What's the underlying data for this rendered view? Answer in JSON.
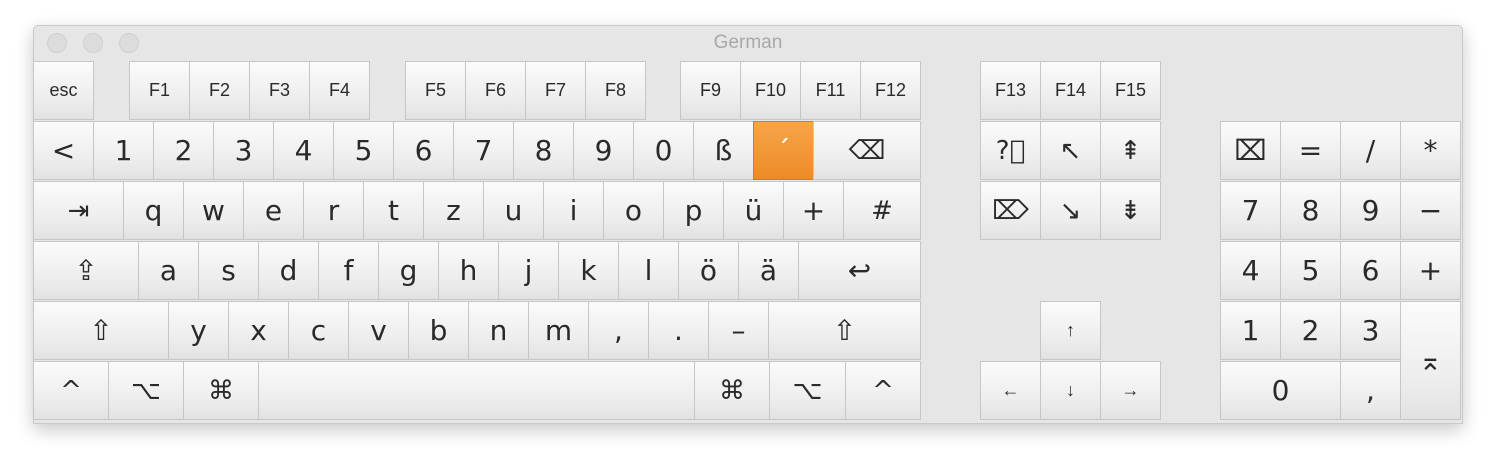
{
  "window": {
    "title": "German",
    "layout": "German"
  },
  "active_key": "´",
  "colors": {
    "active_key": "#F08F2C",
    "background": "#E6E6E6"
  },
  "function_row": [
    "esc",
    "F1",
    "F2",
    "F3",
    "F4",
    "F5",
    "F6",
    "F7",
    "F8",
    "F9",
    "F10",
    "F11",
    "F12",
    "F13",
    "F14",
    "F15"
  ],
  "number_row": [
    "<",
    "1",
    "2",
    "3",
    "4",
    "5",
    "6",
    "7",
    "8",
    "9",
    "0",
    "ß",
    "´",
    "⌫"
  ],
  "top_row": [
    "⇥",
    "q",
    "w",
    "e",
    "r",
    "t",
    "z",
    "u",
    "i",
    "o",
    "p",
    "ü",
    "+",
    "#"
  ],
  "home_row": [
    "⇪",
    "a",
    "s",
    "d",
    "f",
    "g",
    "h",
    "j",
    "k",
    "l",
    "ö",
    "ä",
    "↩"
  ],
  "bottom_row": [
    "⇧",
    "y",
    "x",
    "c",
    "v",
    "b",
    "n",
    "m",
    ",",
    ".",
    "–",
    "⇧"
  ],
  "modifier_row": [
    "^",
    "⌥",
    "⌘",
    "",
    "⌘",
    "⌥",
    "^"
  ],
  "nav_cluster": [
    "?⃝",
    "↖",
    "⇞",
    "⌦",
    "↘",
    "⇟"
  ],
  "arrows": [
    "↑",
    "←",
    "↓",
    "→"
  ],
  "numpad": [
    "⌧",
    "=",
    "/",
    "*",
    "7",
    "8",
    "9",
    "−",
    "4",
    "5",
    "6",
    "+",
    "1",
    "2",
    "3",
    "⌅",
    "0",
    ","
  ]
}
